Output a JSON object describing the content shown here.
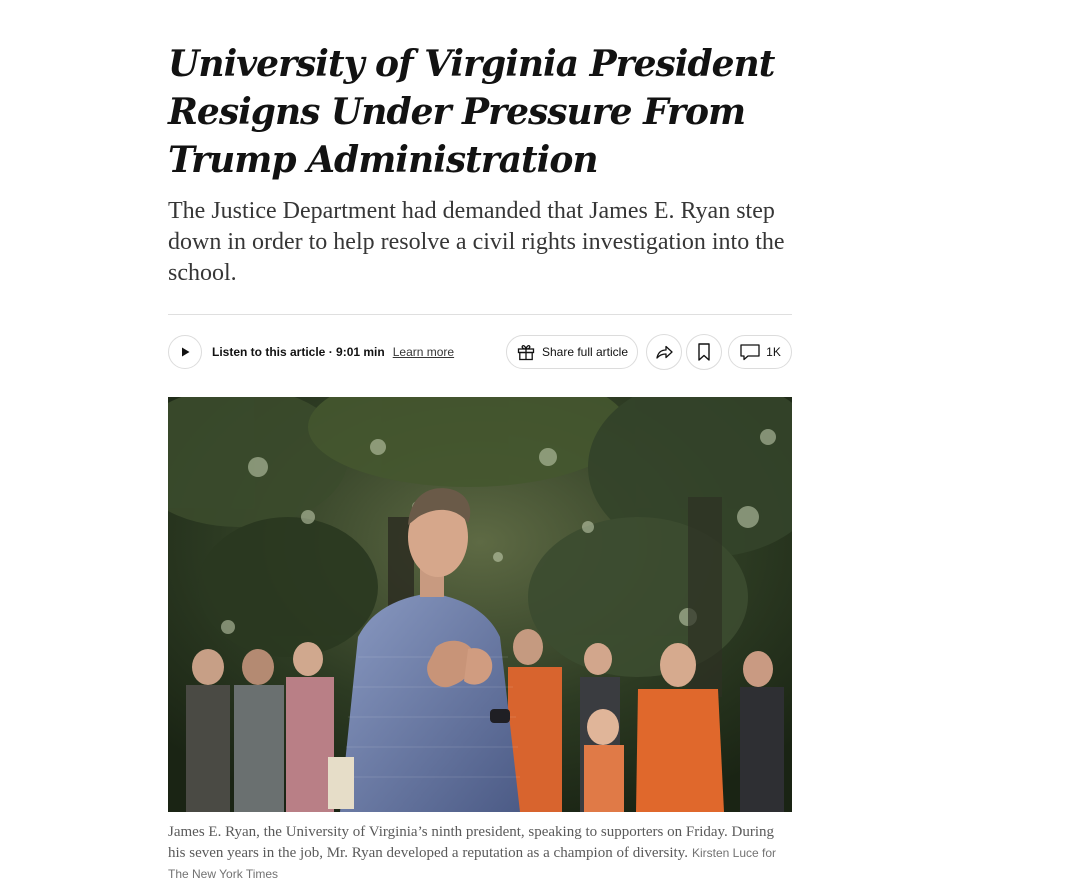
{
  "article": {
    "headline": "University of Virginia President Resigns Under Pressure From Trump Administration",
    "summary": "The Justice Department had demanded that James E. Ryan step down in order to help resolve a civil rights investigation into the school."
  },
  "toolbar": {
    "listen_label": "Listen to this article",
    "listen_separator": " · ",
    "listen_duration": "9:01 min",
    "learn_more": "Learn more",
    "share_label": "Share full article",
    "comments_count": "1K"
  },
  "photo": {
    "caption": "James E. Ryan, the University of Virginia’s ninth president, speaking to supporters on Friday. During his seven years in the job, Mr. Ryan developed a reputation as a champion of diversity.",
    "credit": "Kirsten Luce for The New York Times"
  },
  "icons": {
    "play": "play-icon",
    "gift": "gift-icon",
    "share": "share-arrow-icon",
    "bookmark": "bookmark-icon",
    "comment": "comment-icon"
  },
  "colors": {
    "text": "#121212",
    "summary": "#363636",
    "caption": "#5a5a5a",
    "border": "#dcdcdc"
  }
}
